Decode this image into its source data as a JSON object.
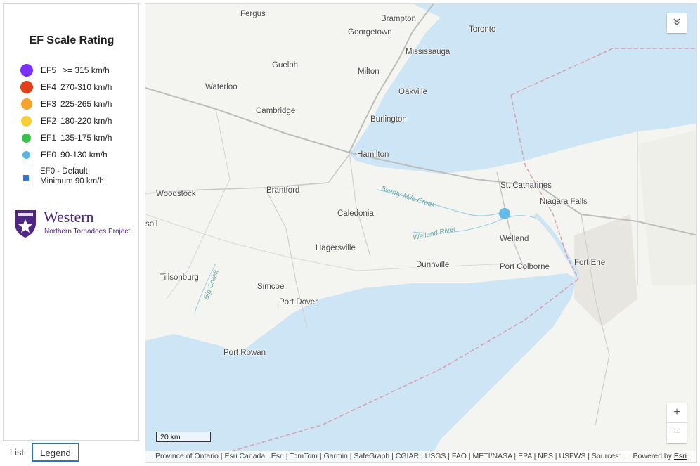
{
  "legend": {
    "title": "EF Scale Rating",
    "items": [
      {
        "code": "EF5",
        "range": ">= 315 km/h",
        "color": "#7b2ff7",
        "size": "large"
      },
      {
        "code": "EF4",
        "range": "270-310 km/h",
        "color": "#e0401c",
        "size": "large"
      },
      {
        "code": "EF3",
        "range": "225-265 km/h",
        "color": "#f5a32a",
        "size": "medium"
      },
      {
        "code": "EF2",
        "range": "180-220 km/h",
        "color": "#f5d030",
        "size": "medium"
      },
      {
        "code": "EF1",
        "range": "135-175 km/h",
        "color": "#36c24a",
        "size": "small"
      },
      {
        "code": "EF0",
        "range": "90-130 km/h",
        "color": "#56b4e9",
        "size": "small"
      }
    ],
    "default_item": {
      "line1": "EF0 - Default",
      "line2": "Minimum 90 km/h",
      "color": "#2b7ad8",
      "shape": "square"
    },
    "logo": {
      "name": "Western",
      "subtitle": "Northern Tornadoes Project",
      "color": "#4f2683"
    }
  },
  "tabs": [
    {
      "label": "List",
      "active": false
    },
    {
      "label": "Legend",
      "active": true
    }
  ],
  "map": {
    "places": [
      "Fergus",
      "Brampton",
      "Toronto",
      "Georgetown",
      "Mississauga",
      "Guelph",
      "Milton",
      "Waterloo",
      "Oakville",
      "Cambridge",
      "Burlington",
      "Hamilton",
      "St. Catharines",
      "Woodstock",
      "Brantford",
      "Niagara Falls",
      "Caledonia",
      "Welland",
      "Hagersville",
      "Dunnville",
      "Port Colborne",
      "Fort Erie",
      "Tillsonburg",
      "Simcoe",
      "Port Dover",
      "Port Rowan",
      "soll"
    ],
    "water_labels": [
      "Twenty Mile Creek",
      "Welland River",
      "Big Creek"
    ],
    "scale_label": "20 km",
    "attribution": "Province of Ontario | Esri Canada | Esri | TomTom | Garmin | SafeGraph | CGIAR | USGS | FAO | METI/NASA | EPA | NPS | USFWS | Sources: ...",
    "powered_by": "Powered by",
    "powered_brand": "Esri",
    "zoom_in": "+",
    "zoom_out": "−",
    "collapse_icon": "chevron-double-down-icon",
    "colors": {
      "water": "#cde5f5",
      "land": "#f4f4f0",
      "border": "#d6a0b0"
    }
  }
}
